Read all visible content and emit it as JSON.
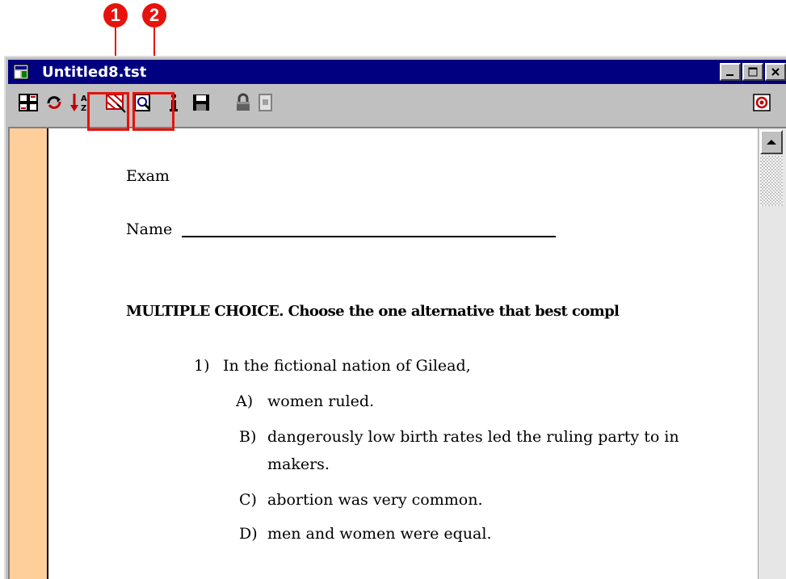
{
  "callouts": [
    "1",
    "2"
  ],
  "window": {
    "title": "Untitled8.tst",
    "controls": [
      "minimize",
      "maximize",
      "close"
    ]
  },
  "toolbar": {
    "items": [
      "layout-icon",
      "refresh-icon",
      "sort-icon",
      "scramble-icon",
      "preview-icon",
      "info-icon",
      "save-icon",
      "lock-icon",
      "locked-page-icon",
      "record-icon"
    ]
  },
  "document": {
    "heading": "Exam",
    "name_label": "Name",
    "instructions": "MULTIPLE CHOICE.  Choose the one alternative that best compl",
    "question": {
      "number": "1)",
      "text": "In the fictional nation of Gilead,",
      "options": [
        {
          "letter": "A)",
          "text": "women ruled."
        },
        {
          "letter": "B)",
          "text": "dangerously low birth rates led the ruling party to in",
          "continuation": "makers."
        },
        {
          "letter": "C)",
          "text": "abortion was very common."
        },
        {
          "letter": "D)",
          "text": "men and women were equal."
        }
      ]
    }
  }
}
